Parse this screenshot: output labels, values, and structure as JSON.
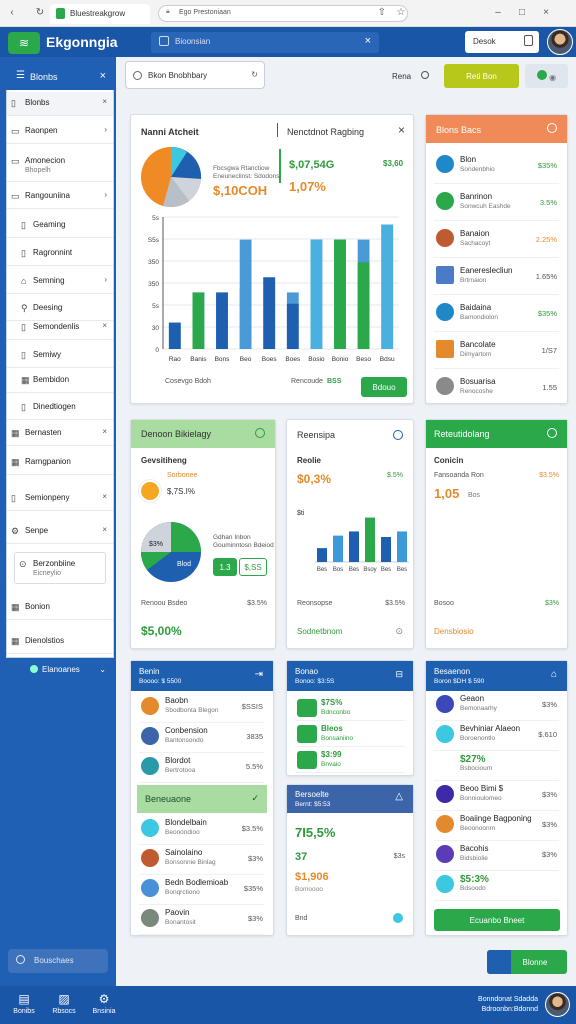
{
  "browser": {
    "tab_title": "Bluestreakgrow",
    "address": "Ego Prestoniaan"
  },
  "app": {
    "brand": "Ekgonngia",
    "search_placeholder": "Bioonsian",
    "user_box": "Desok"
  },
  "sidebar": {
    "title": "Blonbs",
    "items": [
      {
        "label": "Blonbs",
        "icon": "doc",
        "suffix": "×"
      },
      {
        "label": "Raonpen",
        "icon": "folder",
        "suffix": "›"
      },
      {
        "label": "Amonecion",
        "sub": "Bhopelh",
        "icon": "folder",
        "suffix": ""
      },
      {
        "label": "Rangouniina",
        "icon": "folder",
        "suffix": "›"
      },
      {
        "label": "Geaming",
        "icon": "doc",
        "suffix": "",
        "sub_item": true
      },
      {
        "label": "Ragronnint",
        "icon": "doc",
        "suffix": "",
        "sub_item": true
      },
      {
        "label": "Semning",
        "icon": "home",
        "suffix": "›",
        "sub_item": true
      },
      {
        "label": "Deesing",
        "icon": "pin",
        "suffix": "",
        "sub_item": true
      },
      {
        "label": "Semondenlis",
        "icon": "doc",
        "suffix": "×",
        "sub_item": true
      },
      {
        "label": "Semiwy",
        "icon": "doc",
        "suffix": "",
        "sub_item": true
      },
      {
        "label": "Bembidon",
        "icon": "grid",
        "suffix": "",
        "sub_item": true
      },
      {
        "label": "Dinedtiogen",
        "icon": "doc",
        "suffix": "",
        "sub_item": true
      },
      {
        "label": "Bernasten",
        "icon": "grid",
        "suffix": "×"
      },
      {
        "label": "Rarngpanion",
        "icon": "grid",
        "suffix": ""
      },
      {
        "label": "Semionpeny",
        "icon": "doc",
        "suffix": "×"
      },
      {
        "label": "Senpe",
        "icon": "gear",
        "suffix": "×"
      },
      {
        "label": "Berzonbiine",
        "sub": "Eicneylio",
        "icon": "shield",
        "suffix": ""
      },
      {
        "label": "Bonion",
        "icon": "grid",
        "suffix": ""
      },
      {
        "label": "Dienolstios",
        "icon": "grid",
        "suffix": ""
      }
    ],
    "expanded_label": "Elanoanes",
    "footer": "Bouschaes"
  },
  "toolbar": {
    "search": "Bkon Bnobhbary",
    "filter": "Rena",
    "action": "Reti Bon"
  },
  "overview": {
    "title_left": "Nanni Atcheit",
    "title_right": "Nenctdnot Ragbing",
    "value_main": "$,10COH",
    "value_a": "$,07,54G",
    "value_b": "$3,60",
    "value_pct": "1,07%",
    "legend_a": "Fbcsgwa Rtanctiow",
    "legend_b": "Eneuneclinst: Sdodons",
    "footer_left": "Cosevgo Bdoh",
    "footer_mid": "Rencoude",
    "footer_value": "BSS",
    "button": "Bdouo"
  },
  "chart_data": {
    "type": "bar",
    "categories": [
      "Rao",
      "Banis",
      "Bons",
      "Beo",
      "Boes",
      "Boes",
      "Bosio",
      "Bonio",
      "Beso",
      "Bdsu"
    ],
    "series": [
      {
        "values": [
          14,
          30,
          30,
          58,
          38,
          30,
          58,
          58,
          58,
          66
        ]
      },
      {
        "values": [
          0,
          0,
          0,
          32,
          0,
          24,
          0,
          0,
          46,
          0
        ]
      }
    ],
    "yticks": [
      "0",
      "30",
      "5s",
      "350",
      "350",
      "S5s",
      "5s"
    ],
    "ylim": [
      0,
      70
    ]
  },
  "right_list": {
    "title": "Blons Bacs",
    "rows": [
      {
        "a": "Blon",
        "b": "Sondenbhio",
        "v": "$35%",
        "c": "#2f9a3c"
      },
      {
        "a": "Banrinon",
        "b": "Sonwcuh Eashde",
        "v": "3.5%",
        "c": "#2f9a3c"
      },
      {
        "a": "Banaion",
        "b": "Sachacoyt",
        "v": "2.25%",
        "c": "#e58a2c"
      },
      {
        "a": "Eanereslecliun",
        "b": "Brtrnaion",
        "v": "1.65%",
        "c": "#555"
      },
      {
        "a": "Baidaina",
        "b": "Bamondiolon",
        "v": "$35%",
        "c": "#2f9a3c"
      },
      {
        "a": "Bancolate",
        "b": "Dimyartom",
        "v": "1/S7",
        "c": "#555"
      },
      {
        "a": "Bosuarisa",
        "b": "Renocoshe",
        "v": "1.55",
        "c": "#555"
      }
    ]
  },
  "panel_a": {
    "title": "Denoon Bikielagy",
    "subtitle": "Gevsitiheng",
    "badge": "Sorbonee",
    "value": "$,7S.I%",
    "legend_a": "Gdhan Inbon",
    "legend_b": "Gouminntosn Bdeiod",
    "btn_a": "1.3",
    "btn_b": "$,SS",
    "pie_a": "$3%",
    "pie_b": "Blod",
    "row_label": "Renoou Bsdeo",
    "row_val": "$3.5%",
    "total": "$5,00%"
  },
  "panel_b": {
    "title": "Reensipa",
    "label": "Reolie",
    "value": "$0,3%",
    "value2": "$.5%",
    "value3": "$ti",
    "chart_values": [
      10,
      19,
      22,
      32,
      18,
      22
    ],
    "chart_cats": [
      "Bes",
      "Bos",
      "Bes",
      "Bsoy",
      "Bes",
      "Bes"
    ],
    "row_label": "Reonsopse",
    "row_val": "$3.5%",
    "footer": "Sodnetbnom"
  },
  "panel_c": {
    "title": "Reteutidolang",
    "label": "Conicin",
    "sub": "Fansoanda Ron",
    "value_pct": "$3.5%",
    "value": "1,05",
    "unit": "Bos",
    "row_label": "Bosoo",
    "row_val": "$3%",
    "footer": "Densbiosio"
  },
  "list_a": {
    "title": "Benin",
    "subtitle": "Boooo: $ 5500",
    "rows": [
      {
        "a": "Baobn",
        "b": "Sbodbonta Blegon",
        "v": "$SSIS"
      },
      {
        "a": "Conbension",
        "b": "Bantonsondo",
        "v": "3835"
      },
      {
        "a": "Blordot",
        "b": "Bertrotooa",
        "v": "5.5%"
      }
    ]
  },
  "list_b": {
    "title": "Beneuaone",
    "rows": [
      {
        "a": "Blondelbain",
        "b": "Beonondioo",
        "v": "$3.5%"
      },
      {
        "a": "Sainolaino",
        "b": "Bonsonnie Binlag",
        "v": "$3%"
      },
      {
        "a": "Bedn Bodlemioab",
        "b": "Bonqrctiono",
        "v": "$35%"
      },
      {
        "a": "Paovin",
        "b": "Bonantosit",
        "v": "$3%"
      }
    ]
  },
  "list_c": {
    "title": "Bonao",
    "subtitle": "Bonoo: $3:5S",
    "rows": [
      {
        "a": "$7S%",
        "b": "Bdnconbo",
        "v": "",
        "c": "#2f9a3c"
      },
      {
        "a": "Bleos",
        "b": "Bonsaniino",
        "v": "",
        "c": "#2f9a3c"
      },
      {
        "a": "$3:99",
        "b": "Bnvaio",
        "v": "",
        "c": "#2f9a3c"
      }
    ]
  },
  "list_d": {
    "title": "Bersoelte",
    "subtitle": "Bernt: $5:53",
    "v1": "7I5,5%",
    "v2": "37",
    "v2b": "$3s",
    "v3": "$1,906",
    "sub3": "Bomoooo",
    "footer": "Bnd"
  },
  "list_e": {
    "title": "Besaenon",
    "subtitle": "Boron $DH $ 590",
    "rows": [
      {
        "a": "Geaon",
        "b": "Bemonaarhy",
        "v": "$3%"
      },
      {
        "a": "Bevhiniar Alaeon",
        "b": "Boroenontlo",
        "v": "$.610"
      },
      {
        "a": "$27%",
        "b": "Bsbocioum",
        "v": "",
        "big": true
      },
      {
        "a": "Beoo Bimi $",
        "b": "Bonnioulomeo",
        "v": "$3%"
      },
      {
        "a": "Boaiinge Bagponing",
        "b": "Beoonoonrn",
        "v": "$3%"
      },
      {
        "a": "Bacohis",
        "b": "Bidsbiolie",
        "v": "$3%"
      },
      {
        "a": "$5:3%",
        "b": "Bdsoodo",
        "v": "",
        "big": true
      }
    ],
    "button": "Ecuanbo Bneet"
  },
  "fab": "Blonne",
  "bottom_nav": [
    {
      "label": "Bonibs",
      "icon": "▤"
    },
    {
      "label": "Rbsocs",
      "icon": "▨"
    },
    {
      "label": "Bnsinia",
      "icon": "⚙"
    }
  ],
  "bottom_right": {
    "line1": "Bonndonat Sdadda",
    "line2": "Bdroonbn:Bdonnd"
  }
}
